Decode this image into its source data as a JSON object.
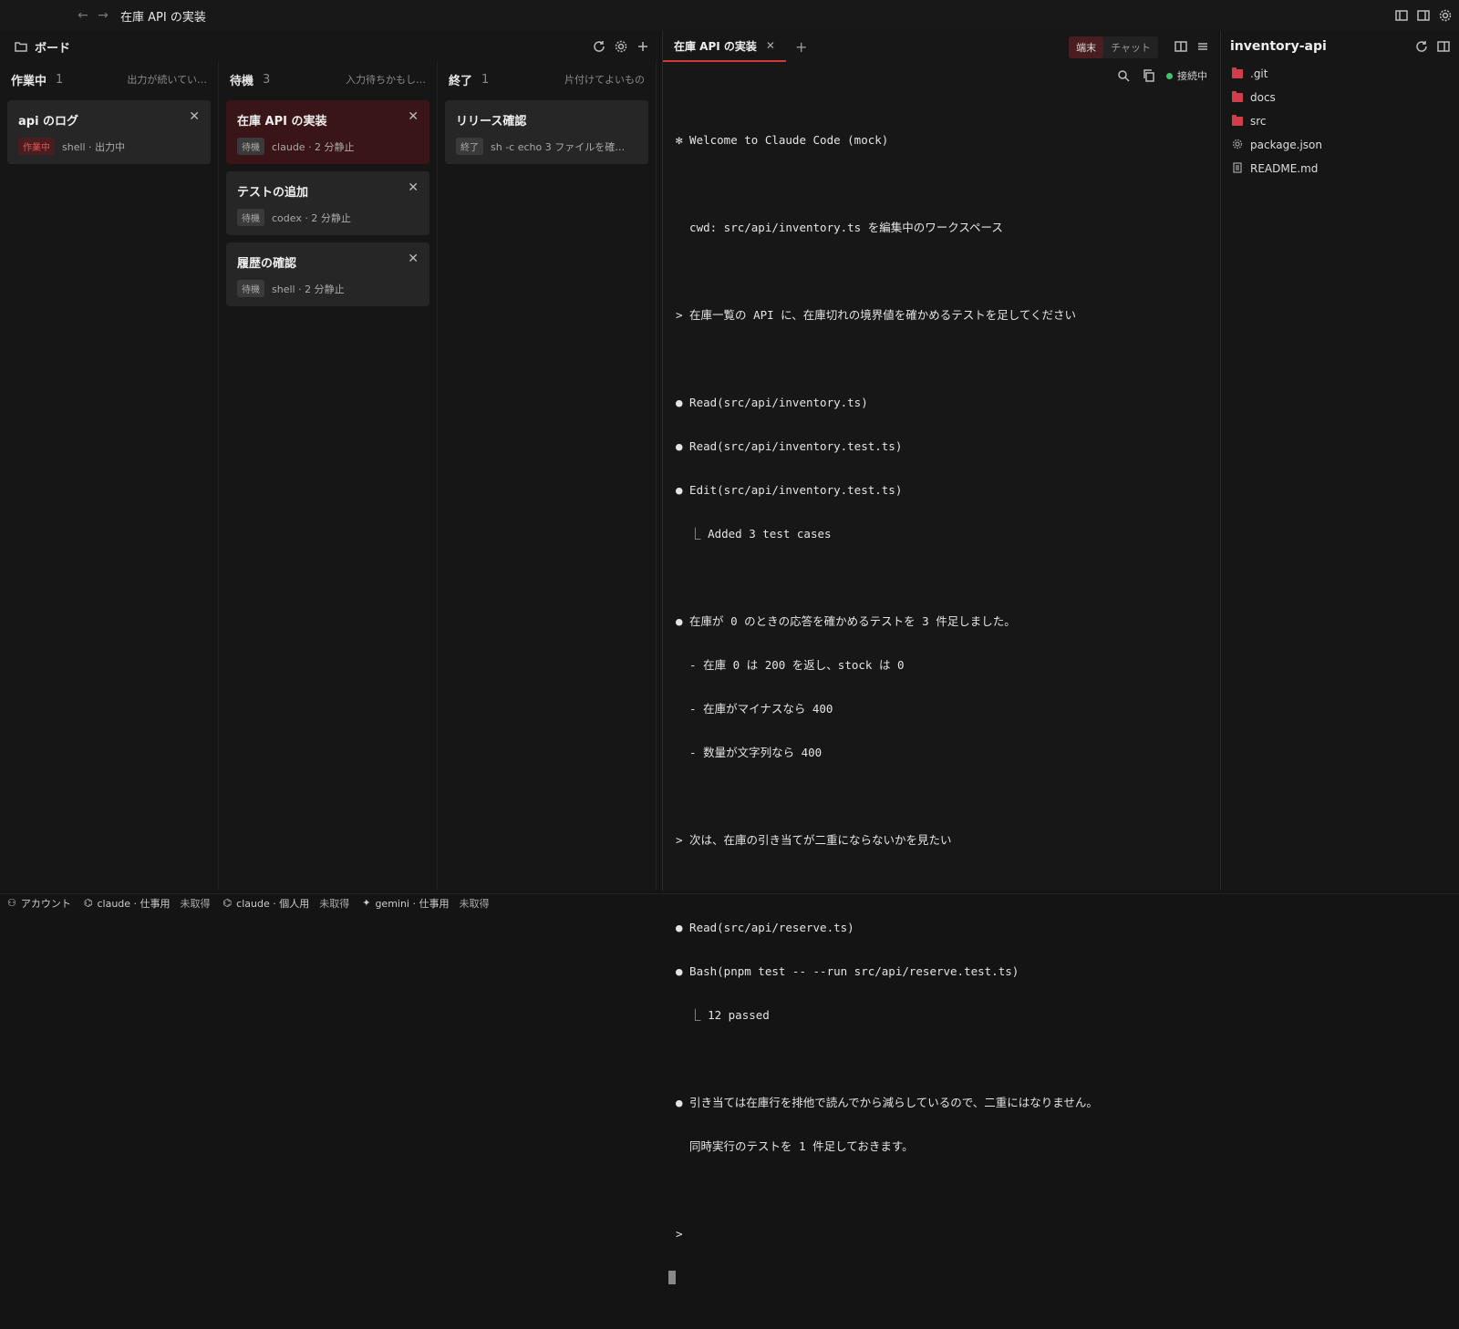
{
  "window": {
    "title": "在庫 API の実装"
  },
  "board": {
    "title": "ボード",
    "columns": [
      {
        "title": "作業中",
        "count": "1",
        "hint": "出力が続いてい…",
        "cards": [
          {
            "title": "api のログ",
            "badge": "作業中",
            "meta": "shell · 出力中"
          }
        ]
      },
      {
        "title": "待機",
        "count": "3",
        "hint": "入力待ちかもし…",
        "cards": [
          {
            "title": "在庫 API の実装",
            "badge": "待機",
            "meta": "claude · 2 分静止"
          },
          {
            "title": "テストの追加",
            "badge": "待機",
            "meta": "codex · 2 分静止"
          },
          {
            "title": "履歴の確認",
            "badge": "待機",
            "meta": "shell · 2 分静止"
          }
        ]
      },
      {
        "title": "終了",
        "count": "1",
        "hint": "片付けてよいもの",
        "cards": [
          {
            "title": "リリース確認",
            "badge": "終了",
            "meta": "sh -c echo 3 ファイルを確…"
          }
        ]
      }
    ]
  },
  "terminal": {
    "tab_label": "在庫 API の実装",
    "seg_terminal": "端末",
    "seg_chat": "チャット",
    "status": "接続中",
    "lines": [
      "✻ Welcome to Claude Code (mock)",
      "",
      "  cwd: src/api/inventory.ts を編集中のワークスペース",
      "",
      "> 在庫一覧の API に、在庫切れの境界値を確かめるテストを足してください",
      "",
      "● Read(src/api/inventory.ts)",
      "● Read(src/api/inventory.test.ts)",
      "● Edit(src/api/inventory.test.ts)",
      "  ⎿ Added 3 test cases",
      "",
      "● 在庫が 0 のときの応答を確かめるテストを 3 件足しました。",
      "  - 在庫 0 は 200 を返し、stock は 0",
      "  - 在庫がマイナスなら 400",
      "  - 数量が文字列なら 400",
      "",
      "> 次は、在庫の引き当てが二重にならないかを見たい",
      "",
      "● Read(src/api/reserve.ts)",
      "● Bash(pnpm test -- --run src/api/reserve.test.ts)",
      "  ⎿ 12 passed",
      "",
      "● 引き当ては在庫行を排他で読んでから減らしているので、二重にはなりません。",
      "  同時実行のテストを 1 件足しておきます。",
      "",
      ">"
    ]
  },
  "files": {
    "title": "inventory-api",
    "items": [
      {
        "name": ".git",
        "kind": "folder"
      },
      {
        "name": "docs",
        "kind": "folder"
      },
      {
        "name": "src",
        "kind": "folder"
      },
      {
        "name": "package.json",
        "kind": "config"
      },
      {
        "name": "README.md",
        "kind": "doc"
      }
    ]
  },
  "statusbar": {
    "account": "アカウント",
    "items": [
      {
        "label": "claude · 仕事用",
        "state": "未取得"
      },
      {
        "label": "claude · 個人用",
        "state": "未取得"
      },
      {
        "label": "gemini · 仕事用",
        "state": "未取得"
      }
    ]
  },
  "colors": {
    "accent": "#d43a3a",
    "folder": "#d13d4a",
    "connected": "#3ec26b"
  }
}
